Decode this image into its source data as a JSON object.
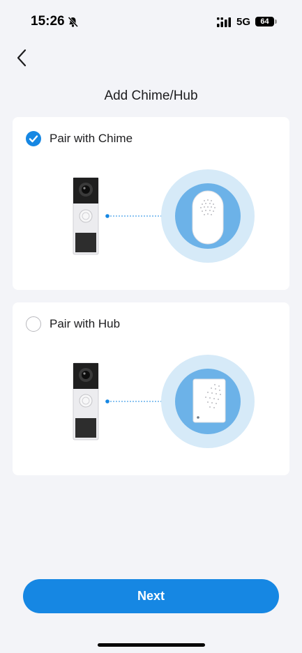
{
  "status_bar": {
    "time": "15:26",
    "network": "5G",
    "battery": "64",
    "icons": [
      "bell-slash-icon",
      "signal-icon",
      "battery-icon"
    ]
  },
  "header": {
    "back_icon": "chevron-left-icon",
    "title": "Add Chime/Hub"
  },
  "options": [
    {
      "label": "Pair with Chime",
      "selected": true,
      "device": "chime"
    },
    {
      "label": "Pair with Hub",
      "selected": false,
      "device": "hub"
    }
  ],
  "footer": {
    "next_label": "Next"
  },
  "colors": {
    "accent": "#1687e3",
    "background": "#f3f4f8",
    "card": "#ffffff"
  }
}
